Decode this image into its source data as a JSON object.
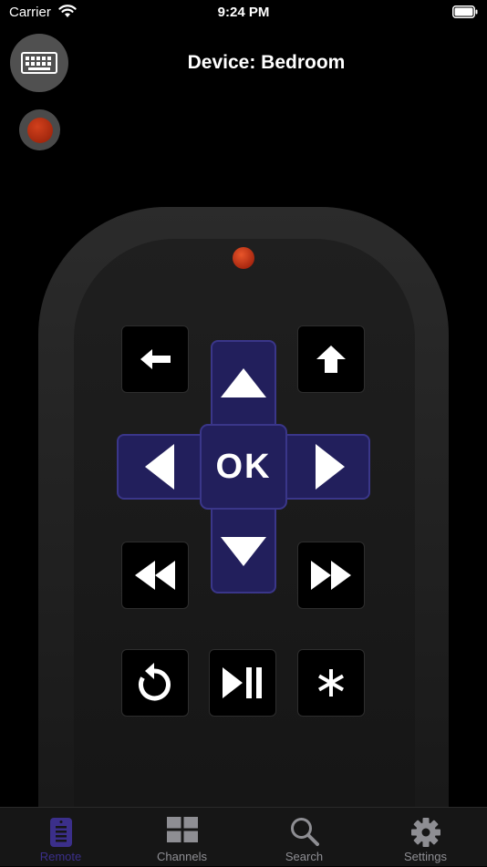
{
  "status_bar": {
    "carrier": "Carrier",
    "time": "9:24 PM"
  },
  "header": {
    "title": "Device: Bedroom"
  },
  "remote": {
    "ok_label": "OK",
    "buttons": [
      "back-arrow",
      "home",
      "dpad-up",
      "dpad-left",
      "dpad-right",
      "dpad-down",
      "rewind",
      "fast-forward",
      "replay",
      "play-pause",
      "options"
    ]
  },
  "tabs": [
    {
      "label": "Remote",
      "icon": "remote-icon",
      "active": true
    },
    {
      "label": "Channels",
      "icon": "channels-grid-icon",
      "active": false
    },
    {
      "label": "Search",
      "icon": "search-icon",
      "active": false
    },
    {
      "label": "Settings",
      "icon": "gear-icon",
      "active": false
    }
  ],
  "colors": {
    "dpad": "#221f5c",
    "dpad_border": "#3a3689",
    "active_tab": "#3b2f8a",
    "record": "#c0391b"
  }
}
